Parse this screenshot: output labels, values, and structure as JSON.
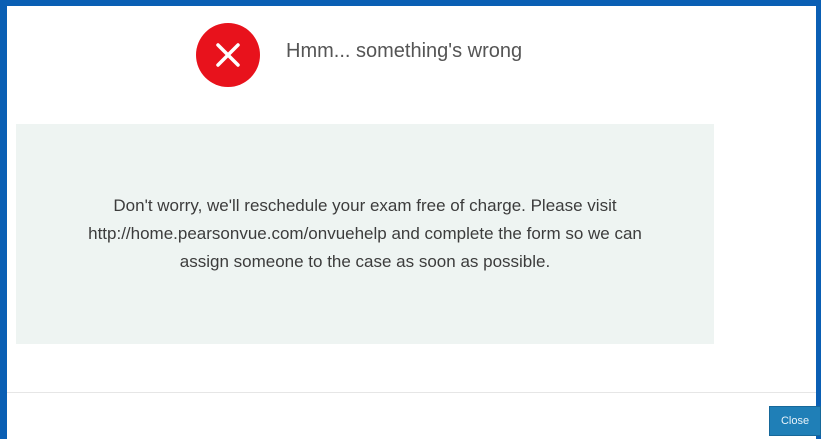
{
  "dialog": {
    "title": "Hmm... something's wrong",
    "icon": "error-x-icon",
    "message": "Don't worry, we'll reschedule your exam free of charge. Please visit http://home.pearsonvue.com/onvuehelp and complete the form so we can assign someone to the case as soon as possible.",
    "close_label": "Close"
  },
  "colors": {
    "frame_border": "#0a5fb4",
    "error_red": "#e8121c",
    "panel_background": "#eef4f2",
    "button_blue": "#1f7fb7"
  }
}
